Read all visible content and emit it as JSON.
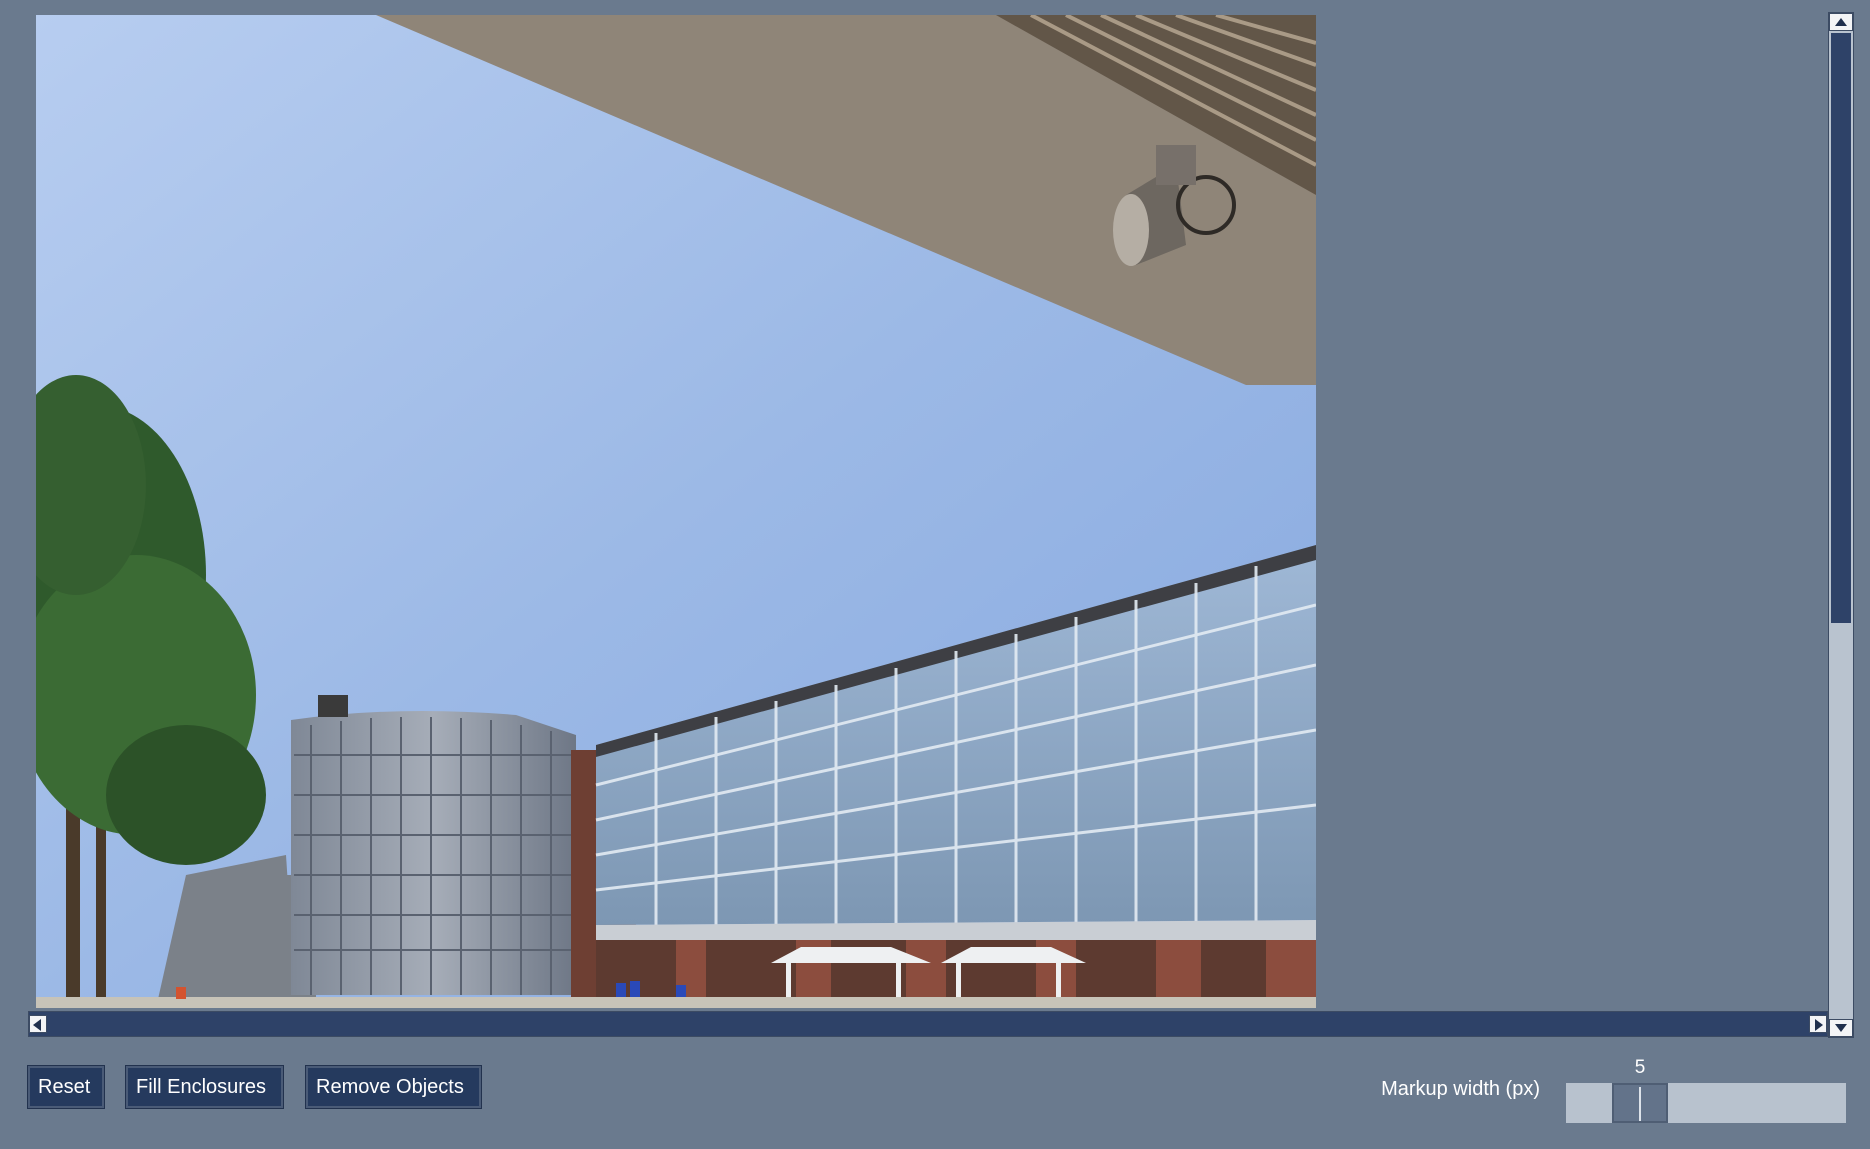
{
  "image": {
    "description_icon": "photo-canvas"
  },
  "toolbar": {
    "reset_label": "Reset",
    "fill_label": "Fill Enclosures",
    "remove_label": "Remove Objects"
  },
  "markup_width": {
    "label": "Markup width (px)",
    "value": "5",
    "fraction": 0.2
  },
  "colors": {
    "background": "#6a7a8e",
    "button": "#253a5e",
    "scrollbar_track": "#2e4268",
    "slider_track": "#b8c2ce"
  }
}
